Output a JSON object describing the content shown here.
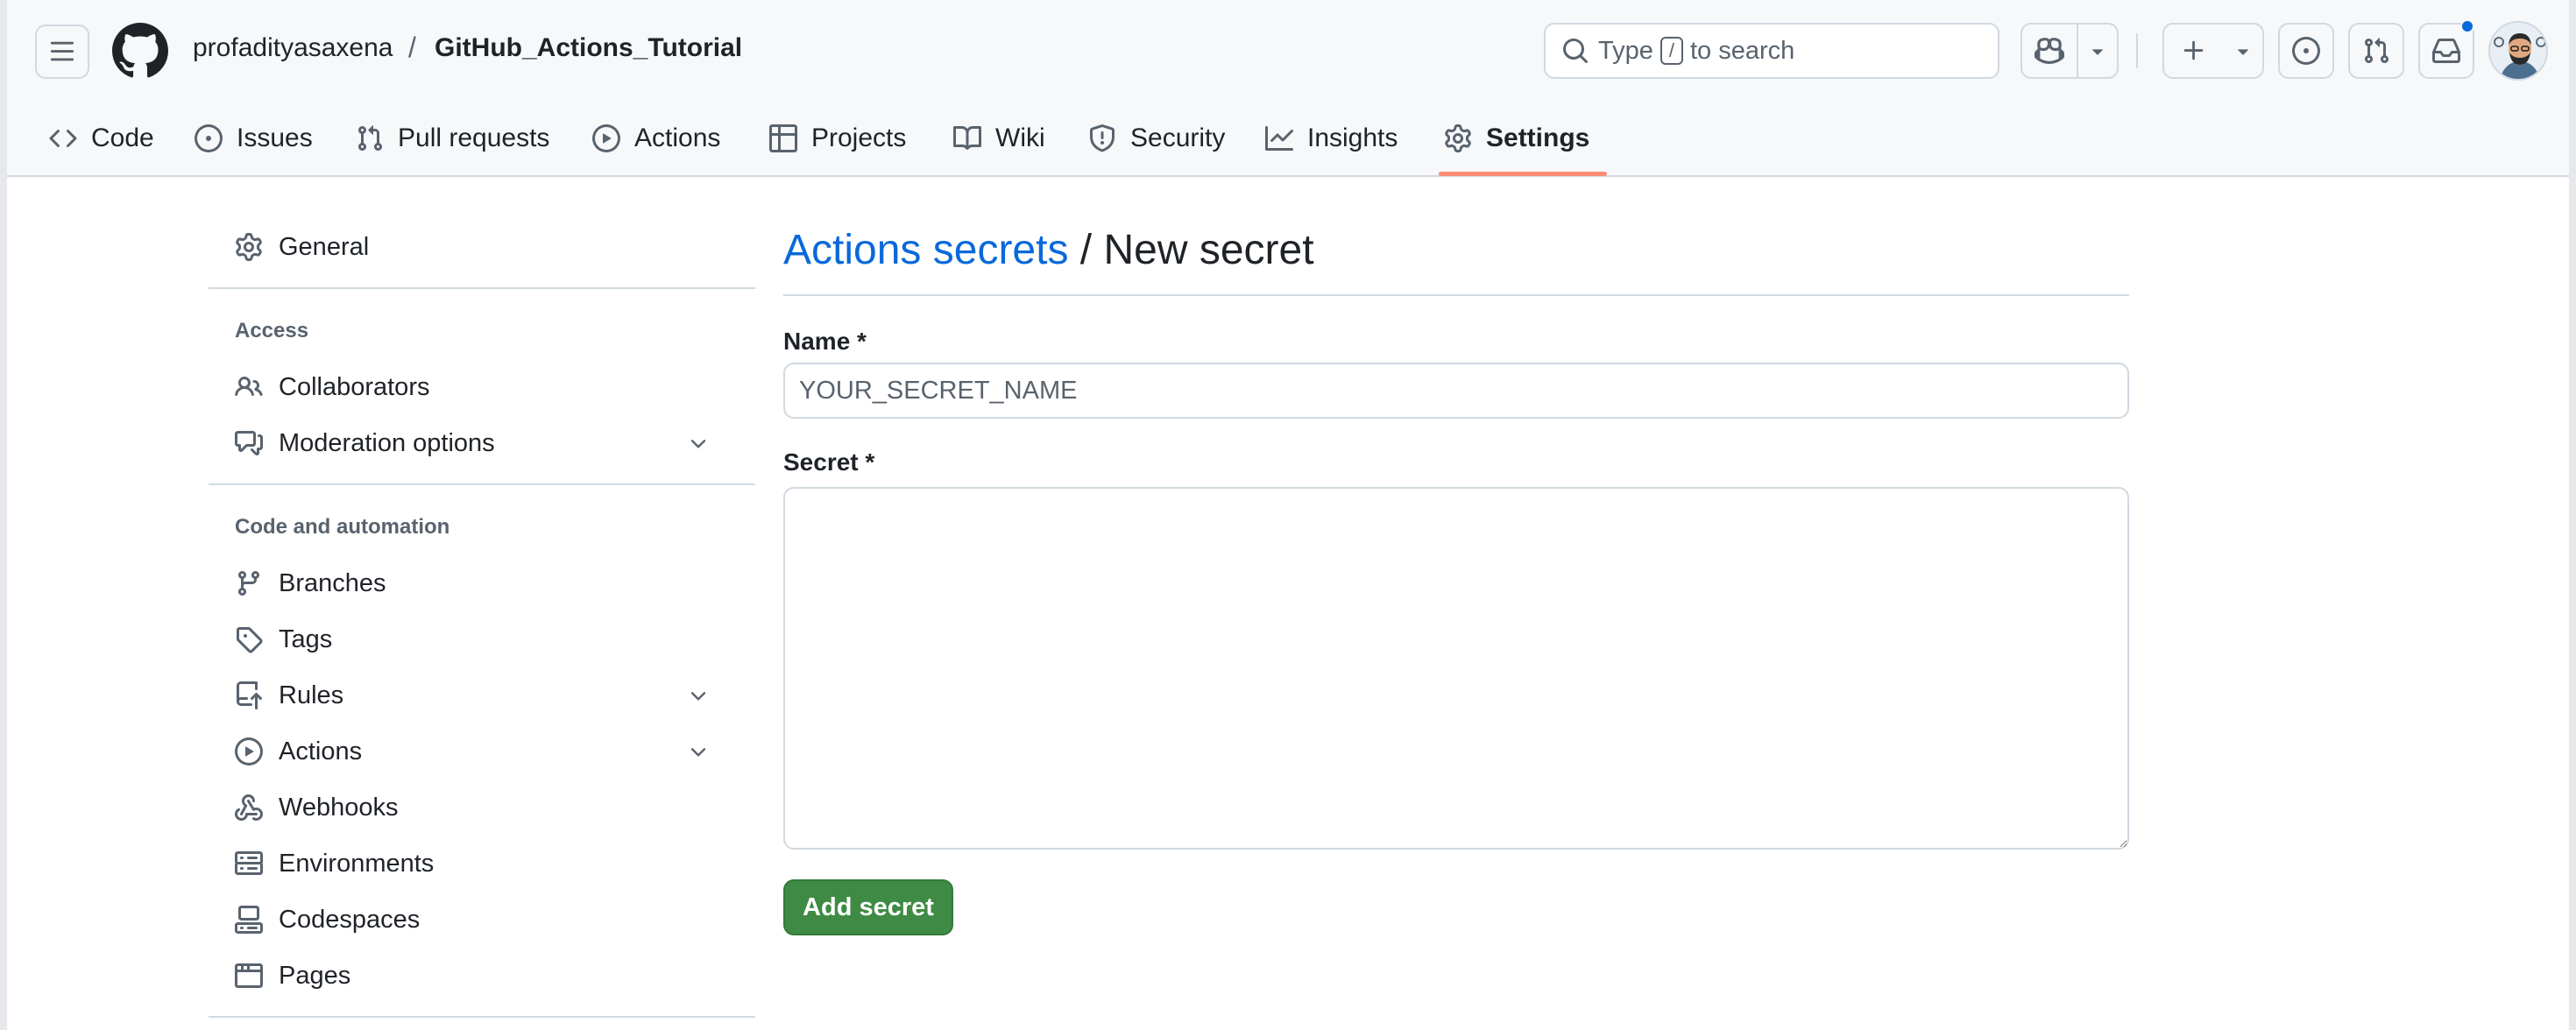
{
  "header": {
    "owner": "profadityasaxena",
    "separator": "/",
    "repo": "GitHub_Actions_Tutorial",
    "search": {
      "before": "Type",
      "key": "/",
      "after": "to search"
    }
  },
  "repo_nav": [
    {
      "label": "Code",
      "icon": "code-icon"
    },
    {
      "label": "Issues",
      "icon": "issue-icon"
    },
    {
      "label": "Pull requests",
      "icon": "pull-request-icon"
    },
    {
      "label": "Actions",
      "icon": "play-icon"
    },
    {
      "label": "Projects",
      "icon": "table-icon"
    },
    {
      "label": "Wiki",
      "icon": "book-icon"
    },
    {
      "label": "Security",
      "icon": "shield-icon"
    },
    {
      "label": "Insights",
      "icon": "graph-icon"
    },
    {
      "label": "Settings",
      "icon": "gear-icon",
      "active": true
    }
  ],
  "sidebar": {
    "general": "General",
    "access_heading": "Access",
    "access": [
      "Collaborators",
      "Moderation options"
    ],
    "code_heading": "Code and automation",
    "code": [
      "Branches",
      "Tags",
      "Rules",
      "Actions",
      "Webhooks",
      "Environments",
      "Codespaces",
      "Pages"
    ]
  },
  "main": {
    "title_link": "Actions secrets",
    "title_rest": " / New secret",
    "name_label": "Name *",
    "name_placeholder": "YOUR_SECRET_NAME",
    "secret_label": "Secret *",
    "submit": "Add secret"
  },
  "colors": {
    "accent_link": "#0969da",
    "primary_button": "#3f8a44",
    "active_tab_underline": "#fd8c73",
    "notification_dot": "#0969da"
  }
}
